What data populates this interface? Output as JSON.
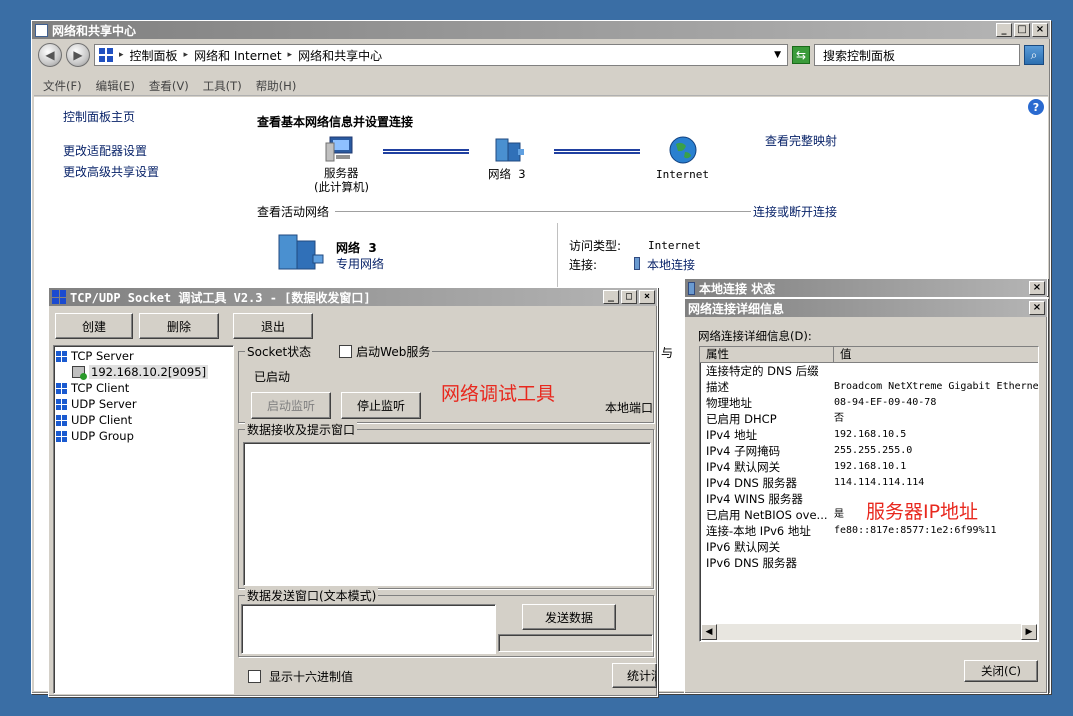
{
  "explorer": {
    "title": "网络和共享中心",
    "breadcrumb": [
      "控制面板",
      "网络和 Internet",
      "网络和共享中心"
    ],
    "search_placeholder": "搜索控制面板",
    "menu": [
      "文件(F)",
      "编辑(E)",
      "查看(V)",
      "工具(T)",
      "帮助(H)"
    ],
    "sidebar": {
      "home": "控制面板主页",
      "links": [
        "更改适配器设置",
        "更改高级共享设置"
      ]
    },
    "heading": "查看基本网络信息并设置连接",
    "map": {
      "computer_label": "服务器",
      "computer_sub": "(此计算机)",
      "network_label": "网络  3",
      "internet_label": "Internet",
      "full_map_link": "查看完整映射"
    },
    "active_networks_label": "查看活动网络",
    "connect_link": "连接或断开连接",
    "network_name": "网络  3",
    "network_type": "专用网络",
    "access_type_label": "访问类型:",
    "access_type_value": "Internet",
    "connections_label": "连接:",
    "connections_value": "本地连接",
    "fragments": [
      "与",
      "本地端口"
    ]
  },
  "tcp_tool": {
    "title": "TCP/UDP Socket 调试工具 V2.3 - [数据收发窗口]",
    "buttons": {
      "create": "创建",
      "delete": "删除",
      "exit": "退出"
    },
    "tree": {
      "tcp_server": "TCP Server",
      "tcp_server_child": "192.168.10.2[9095]",
      "tcp_client": "TCP Client",
      "udp_server": "UDP Server",
      "udp_client": "UDP Client",
      "udp_group": "UDP Group"
    },
    "socket_state_label": "Socket状态",
    "web_service_label": "启动Web服务",
    "state_value": "已启动",
    "start_listen": "启动监听",
    "stop_listen": "停止监听",
    "local_port_label": "本地端口",
    "recv_label": "数据接收及提示窗口",
    "send_label": "数据发送窗口(文本模式)",
    "send_button": "发送数据",
    "hex_label": "显示十六进制值",
    "stats_button": "统计清"
  },
  "status_window": {
    "title": "本地连接 状态"
  },
  "details_window": {
    "title": "网络连接详细信息",
    "section_label": "网络连接详细信息(D):",
    "col_property": "属性",
    "col_value": "值",
    "rows": [
      {
        "k": "连接特定的 DNS 后缀",
        "v": ""
      },
      {
        "k": "描述",
        "v": "Broadcom NetXtreme Gigabit Etherne"
      },
      {
        "k": "物理地址",
        "v": "08-94-EF-09-40-78"
      },
      {
        "k": "已启用 DHCP",
        "v": "否"
      },
      {
        "k": "IPv4 地址",
        "v": "192.168.10.5"
      },
      {
        "k": "IPv4 子网掩码",
        "v": "255.255.255.0"
      },
      {
        "k": "IPv4 默认网关",
        "v": "192.168.10.1"
      },
      {
        "k": "IPv4 DNS 服务器",
        "v": "114.114.114.114"
      },
      {
        "k": "IPv4 WINS 服务器",
        "v": ""
      },
      {
        "k": "已启用 NetBIOS ove...",
        "v": "是"
      },
      {
        "k": "连接-本地 IPv6 地址",
        "v": "fe80::817e:8577:1e2:6f99%11"
      },
      {
        "k": "IPv6 默认网关",
        "v": ""
      },
      {
        "k": "IPv6 DNS 服务器",
        "v": ""
      }
    ],
    "close_button": "关闭(C)"
  },
  "annotations": {
    "tool_note": "网络调试工具",
    "ip_note": "服务器IP地址",
    "color": "#e8281e"
  }
}
